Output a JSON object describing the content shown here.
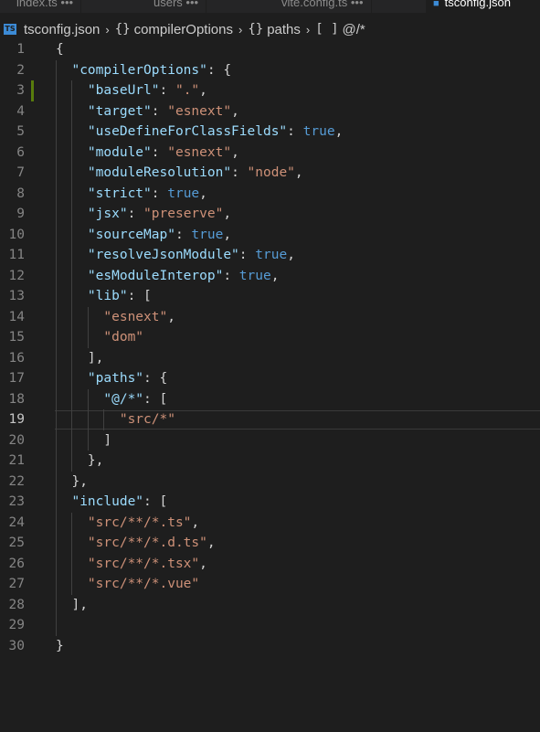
{
  "tabs": [
    {
      "label": "index.ts  •••"
    },
    {
      "label": "users  •••"
    },
    {
      "label": "vite.config.ts  •••"
    },
    {
      "label": "tsconfig.json"
    }
  ],
  "breadcrumb": {
    "file_badge": "TS",
    "file": "tsconfig.json",
    "sep": "›",
    "item1_icon": "{}",
    "item1": "compilerOptions",
    "item2_icon": "{}",
    "item2": "paths",
    "item3_icon": "[ ]",
    "item3": "@/*"
  },
  "editor": {
    "line_numbers": [
      "1",
      "2",
      "3",
      "4",
      "5",
      "6",
      "7",
      "8",
      "9",
      "10",
      "11",
      "12",
      "13",
      "14",
      "15",
      "16",
      "17",
      "18",
      "19",
      "20",
      "21",
      "22",
      "23",
      "24",
      "25",
      "26",
      "27",
      "28",
      "29",
      "30"
    ],
    "active_line": 19,
    "lines": [
      [
        [
          "p",
          "{"
        ]
      ],
      [
        [
          "p",
          "  "
        ],
        [
          "k",
          "\"compilerOptions\""
        ],
        [
          "p",
          ": {"
        ]
      ],
      [
        [
          "p",
          "    "
        ],
        [
          "k",
          "\"baseUrl\""
        ],
        [
          "p",
          ": "
        ],
        [
          "s",
          "\".\""
        ],
        [
          "p",
          ","
        ]
      ],
      [
        [
          "p",
          "    "
        ],
        [
          "k",
          "\"target\""
        ],
        [
          "p",
          ": "
        ],
        [
          "s",
          "\"esnext\""
        ],
        [
          "p",
          ","
        ]
      ],
      [
        [
          "p",
          "    "
        ],
        [
          "k",
          "\"useDefineForClassFields\""
        ],
        [
          "p",
          ": "
        ],
        [
          "b",
          "true"
        ],
        [
          "p",
          ","
        ]
      ],
      [
        [
          "p",
          "    "
        ],
        [
          "k",
          "\"module\""
        ],
        [
          "p",
          ": "
        ],
        [
          "s",
          "\"esnext\""
        ],
        [
          "p",
          ","
        ]
      ],
      [
        [
          "p",
          "    "
        ],
        [
          "k",
          "\"moduleResolution\""
        ],
        [
          "p",
          ": "
        ],
        [
          "s",
          "\"node\""
        ],
        [
          "p",
          ","
        ]
      ],
      [
        [
          "p",
          "    "
        ],
        [
          "k",
          "\"strict\""
        ],
        [
          "p",
          ": "
        ],
        [
          "b",
          "true"
        ],
        [
          "p",
          ","
        ]
      ],
      [
        [
          "p",
          "    "
        ],
        [
          "k",
          "\"jsx\""
        ],
        [
          "p",
          ": "
        ],
        [
          "s",
          "\"preserve\""
        ],
        [
          "p",
          ","
        ]
      ],
      [
        [
          "p",
          "    "
        ],
        [
          "k",
          "\"sourceMap\""
        ],
        [
          "p",
          ": "
        ],
        [
          "b",
          "true"
        ],
        [
          "p",
          ","
        ]
      ],
      [
        [
          "p",
          "    "
        ],
        [
          "k",
          "\"resolveJsonModule\""
        ],
        [
          "p",
          ": "
        ],
        [
          "b",
          "true"
        ],
        [
          "p",
          ","
        ]
      ],
      [
        [
          "p",
          "    "
        ],
        [
          "k",
          "\"esModuleInterop\""
        ],
        [
          "p",
          ": "
        ],
        [
          "b",
          "true"
        ],
        [
          "p",
          ","
        ]
      ],
      [
        [
          "p",
          "    "
        ],
        [
          "k",
          "\"lib\""
        ],
        [
          "p",
          ": ["
        ]
      ],
      [
        [
          "p",
          "      "
        ],
        [
          "s",
          "\"esnext\""
        ],
        [
          "p",
          ","
        ]
      ],
      [
        [
          "p",
          "      "
        ],
        [
          "s",
          "\"dom\""
        ]
      ],
      [
        [
          "p",
          "    ],"
        ]
      ],
      [
        [
          "p",
          "    "
        ],
        [
          "k",
          "\"paths\""
        ],
        [
          "p",
          ": {"
        ]
      ],
      [
        [
          "p",
          "      "
        ],
        [
          "k",
          "\"@/*\""
        ],
        [
          "p",
          ": ["
        ]
      ],
      [
        [
          "p",
          "        "
        ],
        [
          "s",
          "\"src/*\""
        ]
      ],
      [
        [
          "p",
          "      ]"
        ]
      ],
      [
        [
          "p",
          "    },"
        ]
      ],
      [
        [
          "p",
          "  },"
        ]
      ],
      [
        [
          "p",
          "  "
        ],
        [
          "k",
          "\"include\""
        ],
        [
          "p",
          ": ["
        ]
      ],
      [
        [
          "p",
          "    "
        ],
        [
          "s",
          "\"src/**/*.ts\""
        ],
        [
          "p",
          ","
        ]
      ],
      [
        [
          "p",
          "    "
        ],
        [
          "s",
          "\"src/**/*.d.ts\""
        ],
        [
          "p",
          ","
        ]
      ],
      [
        [
          "p",
          "    "
        ],
        [
          "s",
          "\"src/**/*.tsx\""
        ],
        [
          "p",
          ","
        ]
      ],
      [
        [
          "p",
          "    "
        ],
        [
          "s",
          "\"src/**/*.vue\""
        ]
      ],
      [
        [
          "p",
          "  ],"
        ]
      ],
      [
        [
          "p",
          ""
        ]
      ],
      [
        [
          "p",
          "}"
        ]
      ]
    ]
  },
  "colors": {
    "background": "#1e1e1e",
    "property_key": "#9cdcfe",
    "string": "#ce9178",
    "boolean": "#569cd6",
    "punctuation": "#d4d4d4",
    "line_number": "#858585",
    "modified_marker": "#587c0c"
  }
}
